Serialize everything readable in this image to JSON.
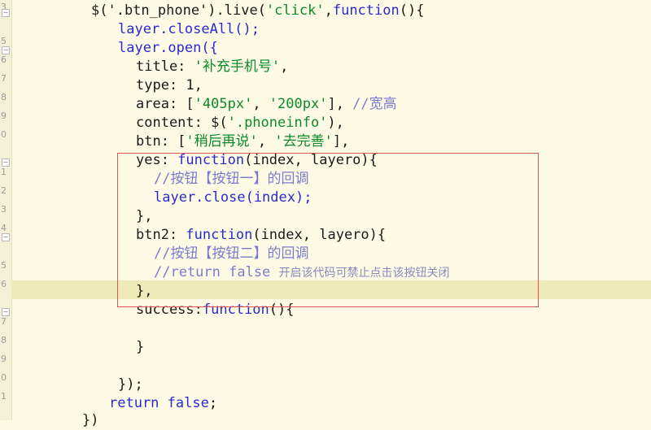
{
  "gutter": {
    "numbers": [
      "3",
      "5",
      "6",
      "7",
      "8",
      "9",
      "0",
      "1",
      "2",
      "3",
      "4",
      "5",
      "6",
      "7",
      "8",
      "9",
      "0",
      "1",
      "2",
      "3",
      "4",
      "5"
    ]
  },
  "code": {
    "l1": [
      "$('.btn_phone').live(",
      "'click'",
      ",",
      "function",
      "(){"
    ],
    "l2": [
      "layer.closeAll();"
    ],
    "l3": [
      "layer.open({"
    ],
    "l4": [
      "title: ",
      "'补充手机号'",
      ","
    ],
    "l5": [
      "type: ",
      "1",
      ","
    ],
    "l6": [
      "area: [",
      "'405px'",
      ", ",
      "'200px'",
      "], ",
      "//宽高"
    ],
    "l7": [
      "content: $(",
      "'.phoneinfo'",
      "),"
    ],
    "l8": [
      "btn: [",
      "'稍后再说'",
      ", ",
      "'去完善'",
      "],"
    ],
    "l9": [
      "yes: ",
      "function",
      "(",
      "index",
      ", ",
      "layero",
      "){"
    ],
    "l10": [
      "//按钮【按钮一】的回调"
    ],
    "l11": [
      "layer.close(index);"
    ],
    "l12": [
      "},"
    ],
    "l13": [
      "btn2: ",
      "function",
      "(",
      "index",
      ", ",
      "layero",
      "){"
    ],
    "l14": [
      "//按钮【按钮二】的回调"
    ],
    "l15": [
      "//return false ",
      "开启该代码可禁止点击该按钮关闭"
    ],
    "l16": [
      "},"
    ],
    "l17": [
      "success:",
      "function",
      "(){"
    ],
    "l18": [
      "}"
    ],
    "l19": [
      "});"
    ],
    "l20": [
      "return ",
      "false",
      ";"
    ],
    "l21": [
      "})"
    ]
  }
}
